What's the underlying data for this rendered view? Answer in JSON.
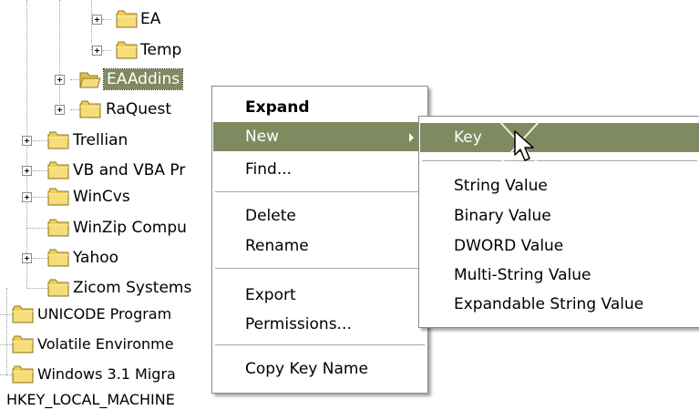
{
  "tree": {
    "items": [
      {
        "label": "EA",
        "expander": true
      },
      {
        "label": "Temp",
        "expander": true
      },
      {
        "label": "EAAddins",
        "expander": true,
        "selected": true
      },
      {
        "label": "RaQuest",
        "expander": true
      },
      {
        "label": "Trellian",
        "expander": true
      },
      {
        "label": "VB and VBA Pr",
        "expander": true
      },
      {
        "label": "WinCvs",
        "expander": true
      },
      {
        "label": "WinZip Compu",
        "expander": false
      },
      {
        "label": "Yahoo",
        "expander": true
      },
      {
        "label": "Zicom Systems",
        "expander": false
      },
      {
        "label": "UNICODE Program",
        "expander": false
      },
      {
        "label": "Volatile Environme",
        "expander": false
      },
      {
        "label": "Windows 3.1 Migra",
        "expander": false
      }
    ],
    "root_label": "HKEY_LOCAL_MACHINE"
  },
  "context_menu": {
    "expand": "Expand",
    "new": "New",
    "find": "Find...",
    "delete": "Delete",
    "rename": "Rename",
    "export": "Export",
    "permissions": "Permissions...",
    "copy_key_name": "Copy Key Name"
  },
  "submenu": {
    "key": "Key",
    "string_value": "String Value",
    "binary_value": "Binary Value",
    "dword_value": "DWORD Value",
    "multi_string_value": "Multi-String Value",
    "expandable_string_value": "Expandable String Value"
  },
  "colors": {
    "highlight": "#7f8a61",
    "folder": "#f5d35a"
  },
  "icons": {
    "folder": "folder-icon",
    "open_folder": "open-folder-icon",
    "expander": "plus-expander-icon",
    "cursor": "mouse-pointer-icon",
    "submenu_arrow": "submenu-arrow-icon"
  }
}
